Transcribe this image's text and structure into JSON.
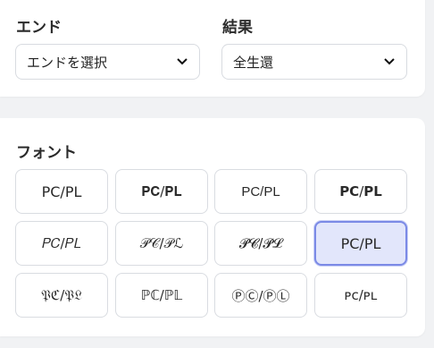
{
  "end_label": "エンド",
  "end_select": {
    "value": "エンドを選択"
  },
  "result_label": "結果",
  "result_select": {
    "value": "全生還"
  },
  "font_label": "フォント",
  "font_options": [
    {
      "text": "PC/PL",
      "selected": false
    },
    {
      "text": "𝐏𝐂/𝐏𝐋",
      "selected": false
    },
    {
      "text": "PC/PL",
      "selected": false
    },
    {
      "text": "𝗣𝗖/𝗣𝗟",
      "selected": false
    },
    {
      "text": "𝑃𝐶/𝑃𝐿",
      "selected": false
    },
    {
      "text": "𝒫𝒞/𝒫ℒ",
      "selected": false
    },
    {
      "text": "𝓟𝓒/𝓟𝓛",
      "selected": false
    },
    {
      "text": "PC/PL",
      "selected": true
    },
    {
      "text": "𝔓ℭ/𝔓𝔏",
      "selected": false
    },
    {
      "text": "ℙℂ/ℙ𝕃",
      "selected": false
    },
    {
      "text": "ⓅⒸ/ⓅⓁ",
      "selected": false
    },
    {
      "text": "ᴘᴄ/ᴘʟ",
      "selected": false
    }
  ],
  "colors": {
    "selected_bg": "#e2e6fb",
    "selected_border": "#7b8ae6"
  },
  "icons": {
    "select_arrow": "chevron-down-icon"
  }
}
